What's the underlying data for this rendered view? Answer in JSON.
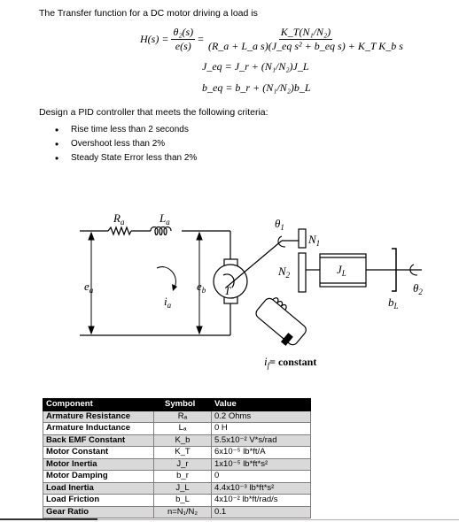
{
  "intro_text": "The Transfer function for a DC motor driving a load is",
  "equations": {
    "main_lhs": "H(s) =",
    "main_frac1_num": "θ₂(s)",
    "main_frac1_den": "e(s)",
    "equals": "=",
    "main_frac2_num": "K_T(N₁/N₂)",
    "main_frac2_den": "(R_a + L_a s)(J_eq s² + b_eq s) + K_T K_b s",
    "jeq": "J_eq = J_r + (N₁/N₂)J_L",
    "beq": "b_eq = b_r + (N₁/N₂)b_L"
  },
  "design_text": "Design a PID controller that meets the following criteria:",
  "criteria": [
    "Rise time less than 2 seconds",
    "Overshoot less than 2%",
    "Steady State Error less than 2%"
  ],
  "diagram": {
    "labels": {
      "Ra": "R",
      "Ra_sub": "a",
      "La": "L",
      "La_sub": "a",
      "ea": "e",
      "ea_sub": "a",
      "eb": "e",
      "eb_sub": "b",
      "ia": "i",
      "ia_sub": "a",
      "T": "T",
      "theta1": "θ",
      "theta1_sub": "1",
      "N1": "N",
      "N1_sub": "1",
      "N2": "N",
      "N2_sub": "2",
      "JL": "J",
      "JL_sub": "L",
      "bL": "b",
      "bL_sub": "L",
      "theta2": "θ",
      "theta2_sub": "2",
      "if_label": "i",
      "if_sub": "f",
      "if_rest": "= constant"
    }
  },
  "table": {
    "headers": [
      "Component",
      "Symbol",
      "Value"
    ],
    "rows": [
      {
        "component": "Armature Resistance",
        "symbol": "Rₐ",
        "value": "0.2 Ohms"
      },
      {
        "component": "Armature Inductance",
        "symbol": "Lₐ",
        "value": "0 H"
      },
      {
        "component": "Back EMF Constant",
        "symbol": "K_b",
        "value": "5.5x10⁻² V*s/rad"
      },
      {
        "component": "Motor Constant",
        "symbol": "K_T",
        "value": "6x10⁻⁵ lb*ft/A"
      },
      {
        "component": "Motor Inertia",
        "symbol": "J_r",
        "value": "1x10⁻⁵ lb*ft*s²"
      },
      {
        "component": "Motor Damping",
        "symbol": "b_r",
        "value": "0"
      },
      {
        "component": "Load Inertia",
        "symbol": "J_L",
        "value": "4.4x10⁻³ lb*ft*s²"
      },
      {
        "component": "Load Friction",
        "symbol": "b_L",
        "value": "4x10⁻² lb*ft/rad/s"
      },
      {
        "component": "Gear Ratio",
        "symbol": "n=N₁/N₂",
        "value": "0.1"
      }
    ]
  }
}
